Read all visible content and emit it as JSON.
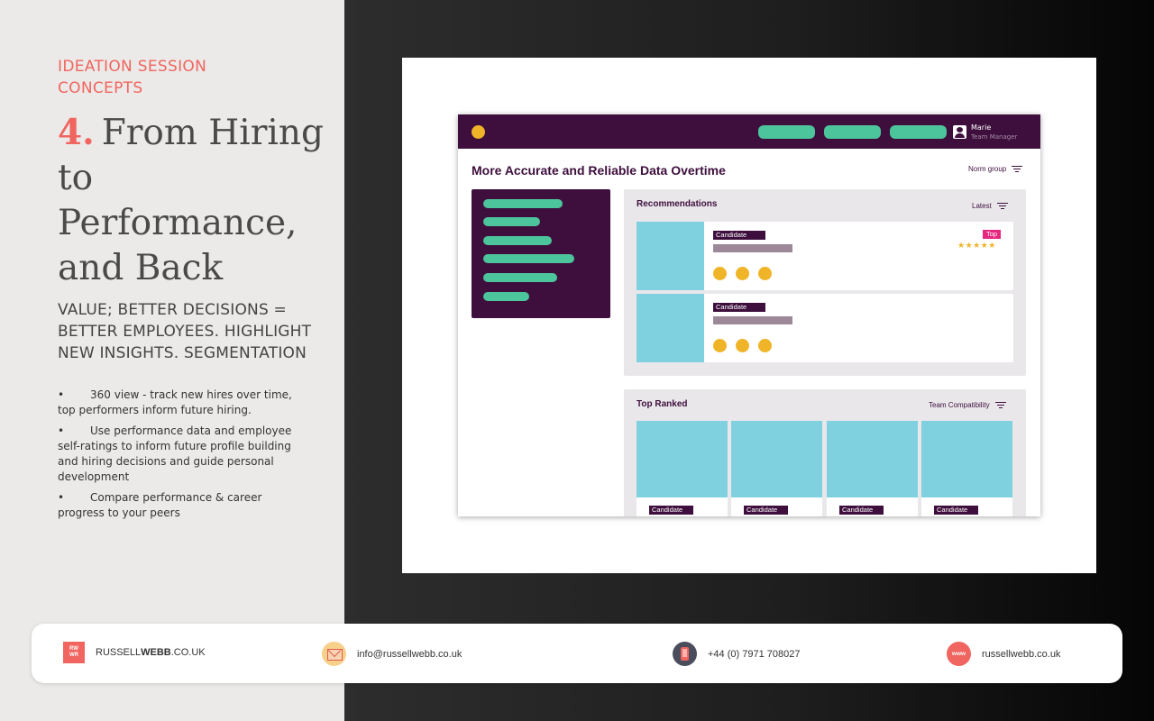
{
  "left_panel": {
    "eyebrow_line1": "IDEATION SESSION",
    "eyebrow_line2": "CONCEPTS",
    "number": "4.",
    "headline": "From Hiring to Performance, and Back",
    "subhead": "VALUE; BETTER DECISIONS = BETTER EMPLOYEES. HIGHLIGHT NEW INSIGHTS. SEGMENTATION",
    "bullet_marker": "•",
    "bullets": [
      "360 view - track new hires over time, top performers inform future hiring.",
      "Use performance data and employee self-ratings to inform future profile building and hiring decisions and guide personal development",
      "Compare performance & career progress to your peers"
    ]
  },
  "mockup": {
    "user": {
      "name": "Marie",
      "role": "Team Manager"
    },
    "title": "More Accurate and Reliable Data Overtime",
    "norm_filter": "Norm group",
    "recommendations": {
      "title": "Recommendations",
      "filter": "Latest",
      "cards": [
        {
          "tag": "Candidate",
          "badge": "Top",
          "stars": "★★★★★"
        },
        {
          "tag": "Candidate"
        }
      ]
    },
    "top_ranked": {
      "title": "Top Ranked",
      "filter": "Team Compatibility",
      "cards": [
        {
          "tag": "Candidate"
        },
        {
          "tag": "Candidate"
        },
        {
          "tag": "Candidate"
        },
        {
          "tag": "Candidate"
        }
      ]
    }
  },
  "footer": {
    "brand_prefix": "RUSSELL",
    "brand_bold": "WEBB",
    "brand_suffix": ".CO.UK",
    "logo_line1": "RW",
    "logo_line2": "WR",
    "email": "info@russellwebb.co.uk",
    "phone": "+44 (0) 7971 708027",
    "web_icon_label": "www",
    "website": "russellwebb.co.uk"
  },
  "colors": {
    "accent": "#f0655f",
    "mock_purple": "#3e0f3d",
    "mock_green": "#4cc49c",
    "mock_cyan": "#7fd1e0",
    "mock_yellow": "#f0b428",
    "mock_pink": "#e5277f"
  }
}
